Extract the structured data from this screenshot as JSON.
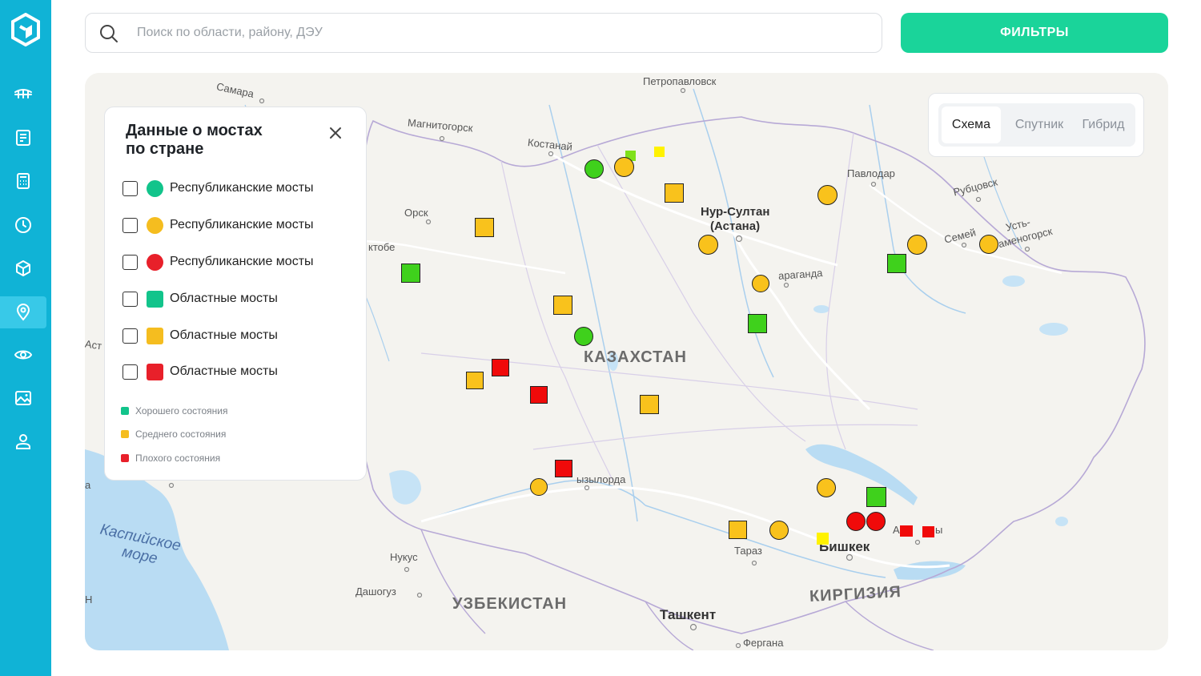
{
  "colors": {
    "sidebar": "#10b3d6",
    "accent": "#1ad49a",
    "good": "#12c48b",
    "medium": "#f5bd1f",
    "bad": "#e8202a",
    "marker_green": "#3fd11c",
    "marker_yellow": "#f9c21c",
    "marker_red": "#f00a0a"
  },
  "sidebar": {
    "items": [
      {
        "icon": "bridge-icon",
        "active": false
      },
      {
        "icon": "document-icon",
        "active": false
      },
      {
        "icon": "calculator-icon",
        "active": false
      },
      {
        "icon": "clock-icon",
        "active": false
      },
      {
        "icon": "cube-icon",
        "active": false
      },
      {
        "icon": "map-pin-icon",
        "active": true
      },
      {
        "icon": "eye-icon",
        "active": false
      },
      {
        "icon": "image-icon",
        "active": false
      },
      {
        "icon": "user-icon",
        "active": false
      }
    ]
  },
  "search": {
    "placeholder": "Поиск по области, району, ДЭУ",
    "value": ""
  },
  "filters_label": "ФИЛЬТРЫ",
  "map_type": {
    "options": [
      "Схема",
      "Спутник",
      "Гибрид"
    ],
    "selected": "Схема"
  },
  "legend": {
    "title_line1": "Данные о мостах",
    "title_line2": "по стране",
    "items": [
      {
        "label": "Республиканские мосты",
        "shape": "circle",
        "color": "#12c48b",
        "checked": false
      },
      {
        "label": "Республиканские мосты",
        "shape": "circle",
        "color": "#f5bd1f",
        "checked": false
      },
      {
        "label": "Республиканские мосты",
        "shape": "circle",
        "color": "#e8202a",
        "checked": false
      },
      {
        "label": "Областные мосты",
        "shape": "square",
        "color": "#12c48b",
        "checked": false
      },
      {
        "label": "Областные мосты",
        "shape": "square",
        "color": "#f5bd1f",
        "checked": false
      },
      {
        "label": "Областные мосты",
        "shape": "square",
        "color": "#e8202a",
        "checked": false
      }
    ],
    "statuses": [
      {
        "label": "Хорошего состояния",
        "color": "#12c48b"
      },
      {
        "label": "Среднего состояния",
        "color": "#f5bd1f"
      },
      {
        "label": "Плохого состояния",
        "color": "#e8202a"
      }
    ]
  },
  "map": {
    "labels": {
      "samara": "Самара",
      "petropavlovsk": "Петропавловск",
      "magnitogorsk": "Магнитогорск",
      "kostanay": "Костанай",
      "pavlodar": "Павлодар",
      "rubtsovsk": "Рубцовск",
      "orsk": "Орск",
      "nursultan": "Нур-Султан",
      "astana": "(Астана)",
      "semey": "Семей",
      "ustkamenogorsk_1": "Усть-",
      "ustkamenogorsk_2": "аменогорск",
      "aktobe": "ктобе",
      "karaganda": "араганда",
      "ast": "Аст",
      "kazakhstan": "КАЗАХСТАН",
      "kyzylorda": "ызылорда",
      "caspian_1": "Каспийское",
      "caspian_2": "море",
      "nukus": "Нукус",
      "taraz": "Тараз",
      "bishkek": "Бишкек",
      "almaty_a": "А",
      "almaty_rest": "ы",
      "dashoguz": "Дашогуз",
      "uzbekistan": "УЗБЕКИСТАН",
      "kyrgyzstan": "КИРГИЗИЯ",
      "tashkent": "Ташкент",
      "fergana": "Фергана",
      "map_edge_a": "а",
      "map_edge_n": "Н"
    }
  }
}
